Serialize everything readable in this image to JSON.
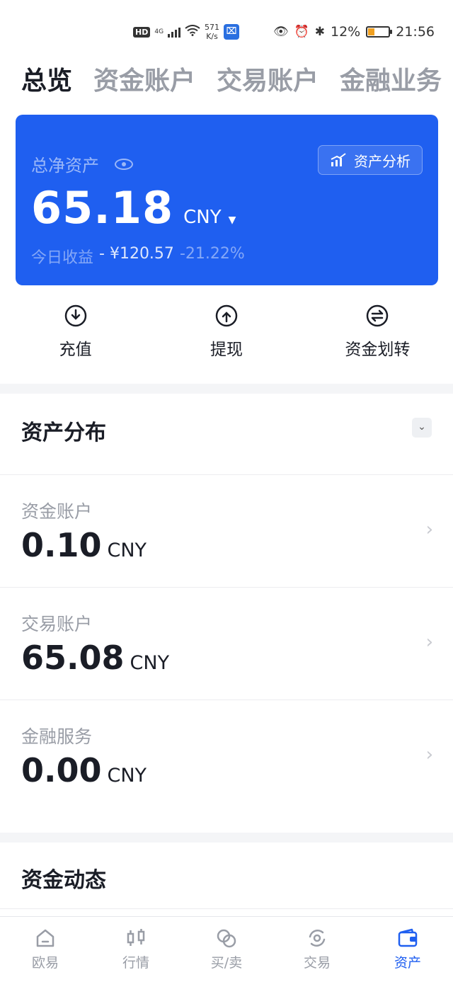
{
  "status_bar": {
    "hd": "HD",
    "signal": "4G",
    "speed_value": "571",
    "speed_unit": "K/s",
    "battery_pct": "12%",
    "time": "21:56",
    "icons": [
      "eye-icon",
      "alarm-icon",
      "bluetooth-icon"
    ]
  },
  "tabs": [
    {
      "label": "总览",
      "active": true
    },
    {
      "label": "资金账户",
      "active": false
    },
    {
      "label": "交易账户",
      "active": false
    },
    {
      "label": "金融业务",
      "active": false
    }
  ],
  "summary_card": {
    "label": "总净资产",
    "analysis_button": "资产分析",
    "amount": "65.18",
    "currency": "CNY",
    "pnl_label": "今日收益",
    "pnl_value": "- ¥120.57",
    "pnl_percent": "-21.22%",
    "bg_color": "#1f5ff0"
  },
  "actions": [
    {
      "label": "充值",
      "icon": "download-icon"
    },
    {
      "label": "提现",
      "icon": "upload-icon"
    },
    {
      "label": "资金划转",
      "icon": "transfer-icon"
    }
  ],
  "asset_distribution": {
    "title": "资产分布",
    "rows": [
      {
        "label": "资金账户",
        "amount": "0.10",
        "currency": "CNY"
      },
      {
        "label": "交易账户",
        "amount": "65.08",
        "currency": "CNY"
      },
      {
        "label": "金融服务",
        "amount": "0.00",
        "currency": "CNY"
      }
    ]
  },
  "fund_activity": {
    "title": "资金动态"
  },
  "bottom_nav": [
    {
      "label": "欧易",
      "icon": "home-icon",
      "active": false
    },
    {
      "label": "行情",
      "icon": "candlestick-icon",
      "active": false
    },
    {
      "label": "买/卖",
      "icon": "buy-sell-icon",
      "active": false
    },
    {
      "label": "交易",
      "icon": "trade-icon",
      "active": false
    },
    {
      "label": "资产",
      "icon": "wallet-icon",
      "active": true
    }
  ],
  "accent_color": "#1f5ff0"
}
